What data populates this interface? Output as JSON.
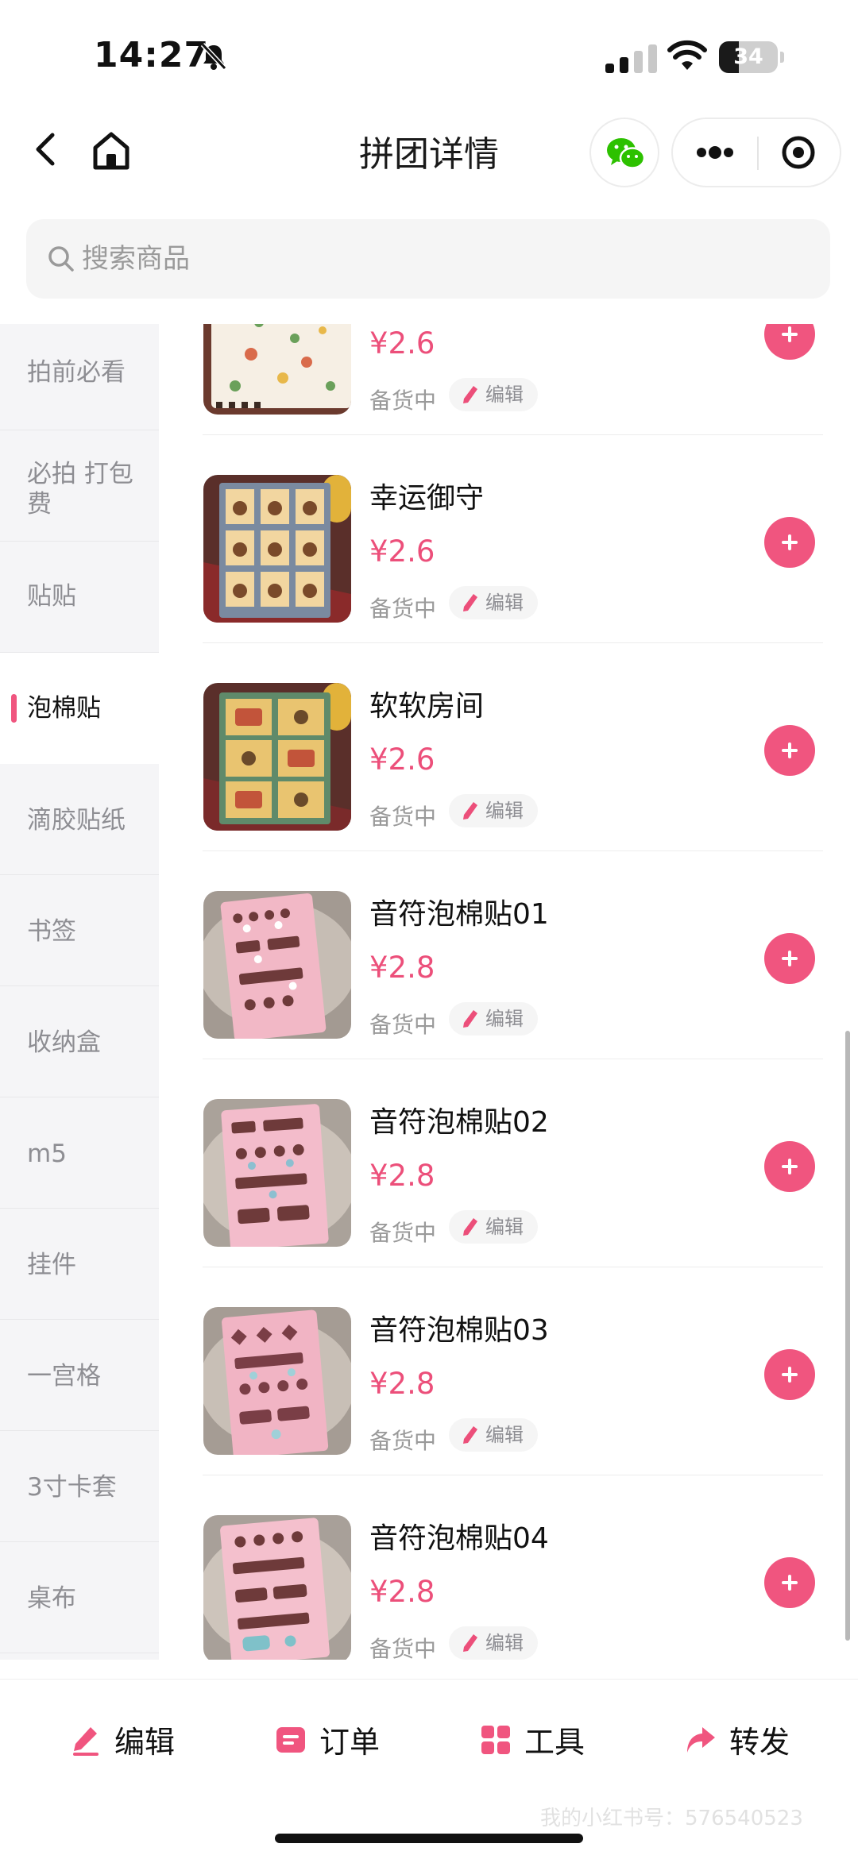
{
  "status_bar": {
    "time": "14:27",
    "battery": "34",
    "battery_level": 0.34
  },
  "nav": {
    "title": "拼团详情"
  },
  "search": {
    "placeholder": "搜索商品"
  },
  "sidebar": {
    "items": [
      {
        "label": "拍前必看"
      },
      {
        "label": "必拍 打包费"
      },
      {
        "label": "贴贴"
      },
      {
        "label": "泡棉贴",
        "active": true
      },
      {
        "label": "滴胶贴纸"
      },
      {
        "label": "书签"
      },
      {
        "label": "收纳盒"
      },
      {
        "label": "m5"
      },
      {
        "label": "挂件"
      },
      {
        "label": "一宫格"
      },
      {
        "label": "3寸卡套"
      },
      {
        "label": "桌布"
      }
    ]
  },
  "products": [
    {
      "name": "",
      "price": "¥2.6",
      "status": "备货中",
      "edit": "编辑"
    },
    {
      "name": "幸运御守",
      "price": "¥2.6",
      "status": "备货中",
      "edit": "编辑"
    },
    {
      "name": "软软房间",
      "price": "¥2.6",
      "status": "备货中",
      "edit": "编辑"
    },
    {
      "name": "音符泡棉贴01",
      "price": "¥2.8",
      "status": "备货中",
      "edit": "编辑"
    },
    {
      "name": "音符泡棉贴02",
      "price": "¥2.8",
      "status": "备货中",
      "edit": "编辑"
    },
    {
      "name": "音符泡棉贴03",
      "price": "¥2.8",
      "status": "备货中",
      "edit": "编辑"
    },
    {
      "name": "音符泡棉贴04",
      "price": "¥2.8",
      "status": "备货中",
      "edit": "编辑"
    }
  ],
  "tabbar": {
    "edit": "编辑",
    "orders": "订单",
    "tools": "工具",
    "share": "转发"
  },
  "watermark": "我的小红书号：576540523",
  "colors": {
    "accent": "#f0557f",
    "price": "#ec4f7a",
    "sidebar_bg": "#f5f5f7"
  }
}
